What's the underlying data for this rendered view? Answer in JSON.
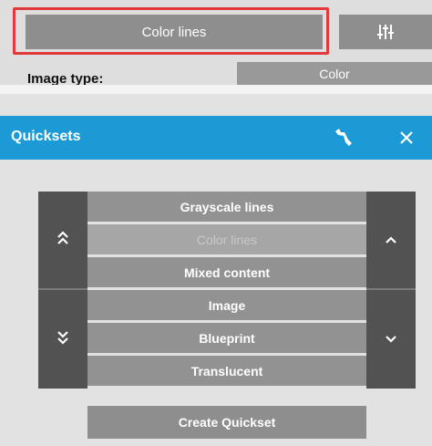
{
  "top_panel": {
    "mode_button_label": "Color lines",
    "image_type_label": "Image type:",
    "image_type_value": "Color",
    "settings_icon": "sliders-icon",
    "highlight_color": "#e23a3a"
  },
  "quicksets": {
    "title": "Quicksets",
    "header_color": "#1c9ad6",
    "wrench_icon": "wrench-icon",
    "close_icon": "close-icon",
    "items": [
      {
        "label": "Grayscale lines"
      },
      {
        "label": "Color lines",
        "selected": true
      },
      {
        "label": "Mixed content"
      },
      {
        "label": "Image"
      },
      {
        "label": "Blueprint"
      },
      {
        "label": "Translucent"
      }
    ],
    "create_label": "Create Quickset"
  }
}
